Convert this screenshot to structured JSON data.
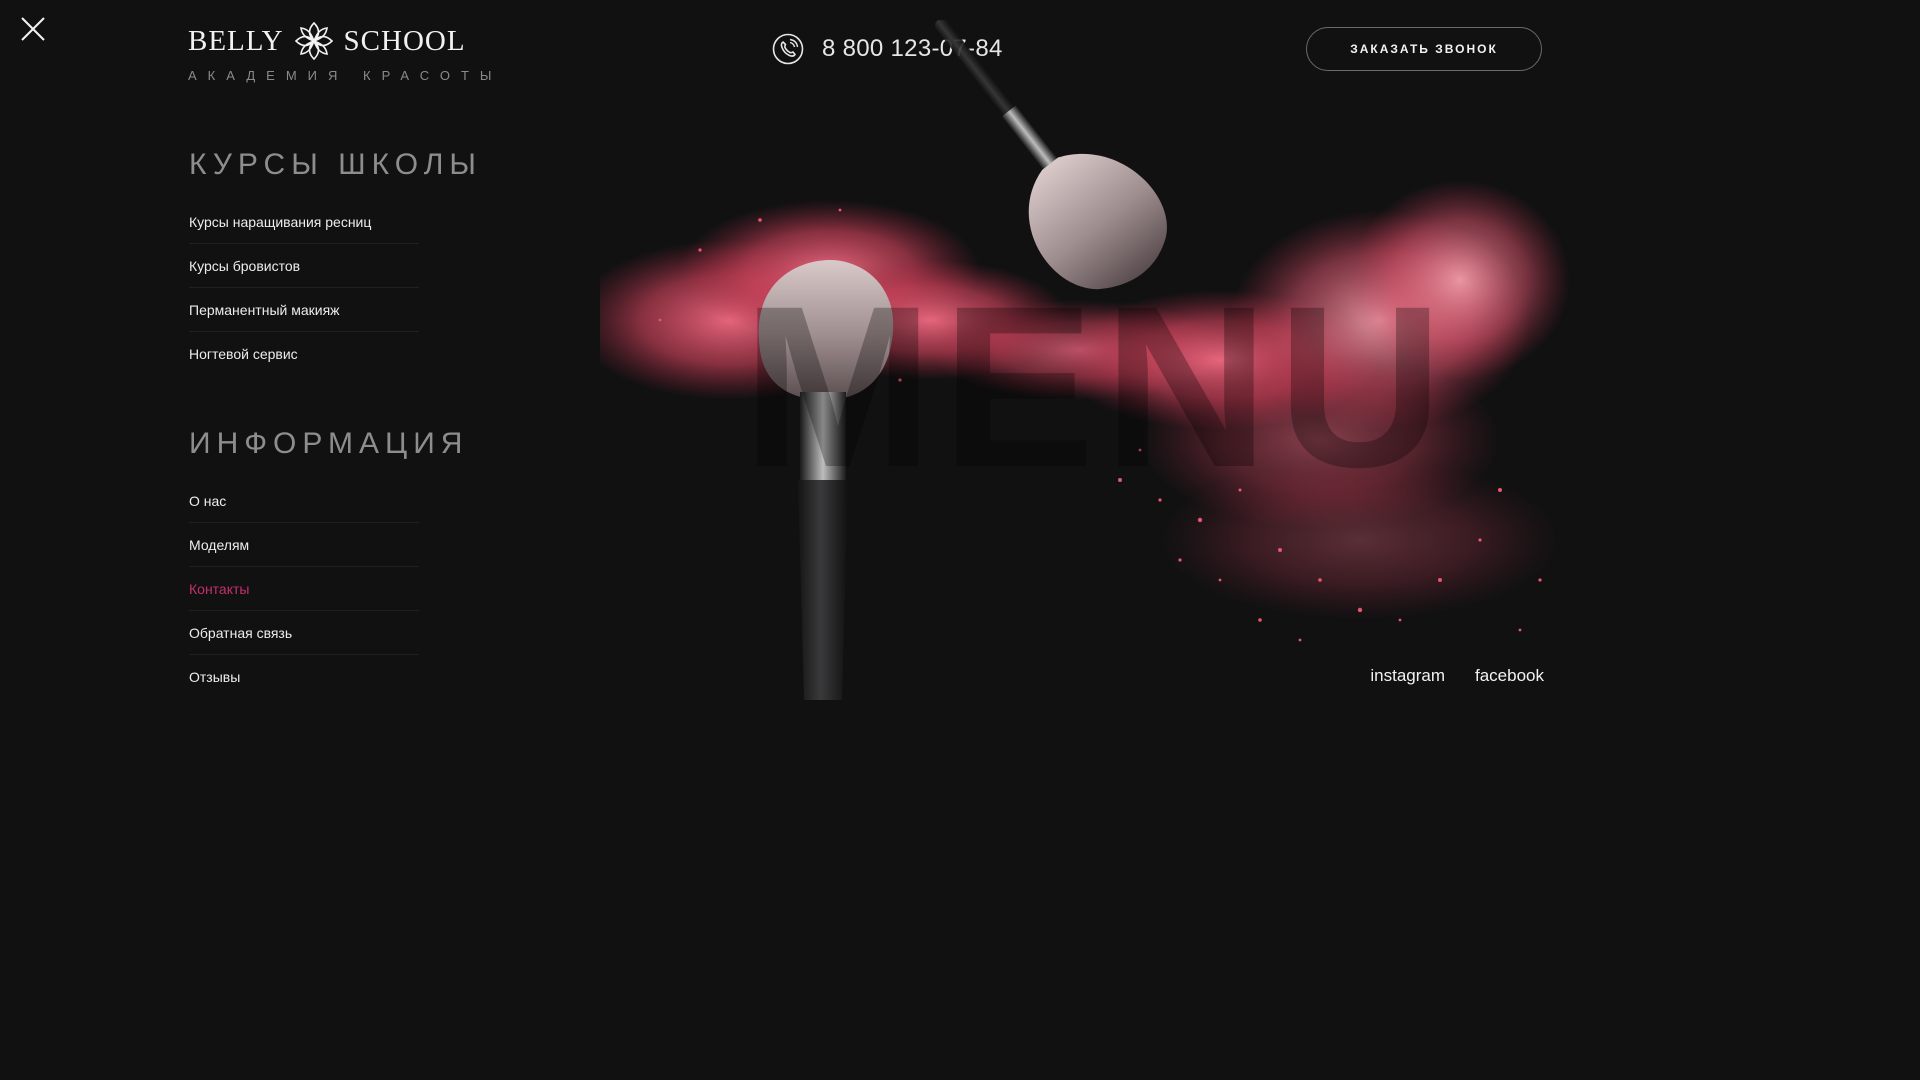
{
  "logo": {
    "left_word": "BELLY",
    "right_word": "SCHOOL",
    "tagline": "АКАДЕМИЯ КРАСОТЫ"
  },
  "header": {
    "phone": "8 800 123-07-84",
    "call_button_label": "ЗАКАЗАТЬ ЗВОНОК"
  },
  "hero": {
    "watermark": "MENU"
  },
  "courses": {
    "title": "КУРСЫ ШКОЛЫ",
    "items": [
      {
        "label": "Курсы наращивания ресниц"
      },
      {
        "label": "Курсы бровистов"
      },
      {
        "label": "Перманентный макияж"
      },
      {
        "label": "Ногтевой сервис"
      }
    ]
  },
  "info": {
    "title": "ИНФОРМАЦИЯ",
    "items": [
      {
        "label": "О нас"
      },
      {
        "label": "Моделям"
      },
      {
        "label": "Контакты",
        "active": true
      },
      {
        "label": "Обратная связь"
      },
      {
        "label": "Отзывы"
      }
    ]
  },
  "socials": {
    "instagram": "instagram",
    "facebook": "facebook"
  },
  "colors": {
    "background": "#111112",
    "accent": "#c2306e",
    "powder": "#e3566f"
  }
}
